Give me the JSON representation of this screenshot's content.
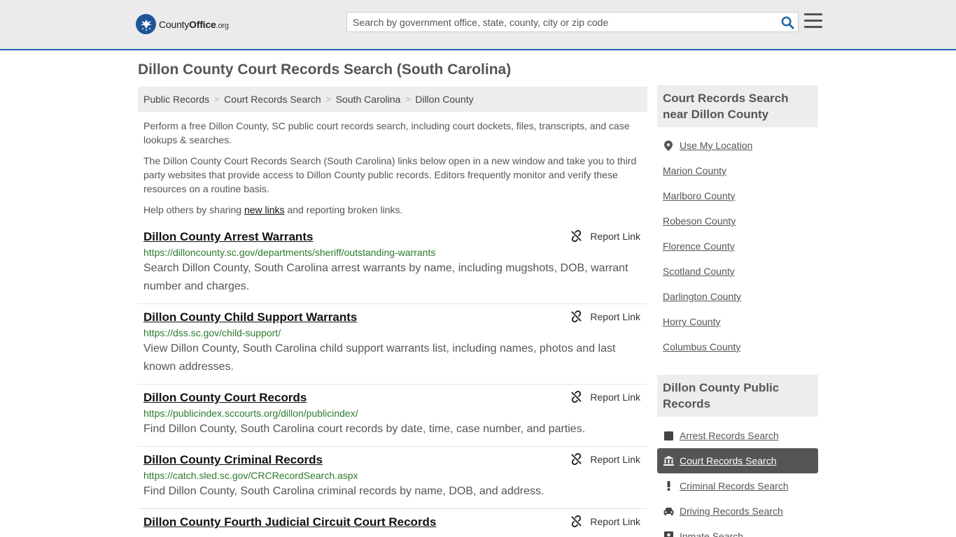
{
  "header": {
    "logo_main": "County",
    "logo_bold": "Office",
    "logo_org": ".org",
    "search_placeholder": "Search by government office, state, county, city or zip code"
  },
  "page_title": "Dillon County Court Records Search (South Carolina)",
  "breadcrumb": [
    "Public Records",
    "Court Records Search",
    "South Carolina",
    "Dillon County"
  ],
  "intro": {
    "p1": "Perform a free Dillon County, SC public court records search, including court dockets, files, transcripts, and case lookups & searches.",
    "p2": "The Dillon County Court Records Search (South Carolina) links below open in a new window and take you to third party websites that provide access to Dillon County public records. Editors frequently monitor and verify these resources on a routine basis.",
    "p3_before": "Help others by sharing ",
    "p3_link": "new links",
    "p3_after": " and reporting broken links."
  },
  "report_label": "Report Link",
  "records": [
    {
      "title": "Dillon County Arrest Warrants",
      "url": "https://dilloncounty.sc.gov/departments/sheriff/outstanding-warrants",
      "desc": "Search Dillon County, South Carolina arrest warrants by name, including mugshots, DOB, warrant number and charges."
    },
    {
      "title": "Dillon County Child Support Warrants",
      "url": "https://dss.sc.gov/child-support/",
      "desc": "View Dillon County, South Carolina child support warrants list, including names, photos and last known addresses."
    },
    {
      "title": "Dillon County Court Records",
      "url": "https://publicindex.sccourts.org/dillon/publicindex/",
      "desc": "Find Dillon County, South Carolina court records by date, time, case number, and parties."
    },
    {
      "title": "Dillon County Criminal Records",
      "url": "https://catch.sled.sc.gov/CRCRecordSearch.aspx",
      "desc": "Find Dillon County, South Carolina criminal records by name, DOB, and address."
    },
    {
      "title": "Dillon County Fourth Judicial Circuit Court Records",
      "url": "",
      "desc": ""
    }
  ],
  "sidebar": {
    "nearby_title": "Court Records Search near Dillon County",
    "use_location": "Use My Location",
    "nearby": [
      "Marion County",
      "Marlboro County",
      "Robeson County",
      "Florence County",
      "Scotland County",
      "Darlington County",
      "Horry County",
      "Columbus County"
    ],
    "public_title": "Dillon County Public Records",
    "public_links": [
      {
        "label": "Arrest Records Search",
        "icon": "square-icon"
      },
      {
        "label": "Court Records Search",
        "icon": "courthouse-icon"
      },
      {
        "label": "Criminal Records Search",
        "icon": "exclamation-icon"
      },
      {
        "label": "Driving Records Search",
        "icon": "car-icon"
      },
      {
        "label": "Inmate Search",
        "icon": "inmate-icon"
      }
    ]
  },
  "colors": {
    "brand_blue": "#1c5497",
    "accent_line": "#1d64a8",
    "url_green": "#2c7a2c",
    "active_bg": "#555555"
  }
}
